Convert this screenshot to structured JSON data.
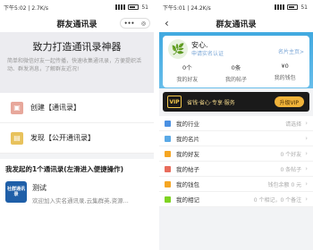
{
  "left": {
    "status": {
      "time": "下午5:02",
      "speed": "2.7K/s",
      "battery": "51"
    },
    "nav": {
      "title": "群友通讯录"
    },
    "hero": {
      "title": "致力打造通讯录神器",
      "desc": "简单和微信好友一起传播，快速收集通讯录，方便提织活动、群发消息，了解群友近况!"
    },
    "actions": [
      {
        "label": "创建【通讯录】"
      },
      {
        "label": "发现【公开通讯录】"
      }
    ],
    "section_title": "我发起的1个通讯录(左滑进入便捷操作)",
    "groups": [
      {
        "logo_text": "社群通讯录",
        "name": "测试",
        "desc": "欢迎加入实名通讯录,云集群英,资源..."
      }
    ]
  },
  "right": {
    "status": {
      "time": "下午5:01",
      "speed": "24.2K/s",
      "battery": "51"
    },
    "nav": {
      "title": "群友通讯录"
    },
    "profile": {
      "username": "安心.",
      "verify_link": "申请实名认证",
      "edit_link": "名片主页>",
      "stats": [
        {
          "value": "0个",
          "label": "我的好友"
        },
        {
          "value": "0条",
          "label": "我的帖子"
        },
        {
          "value": "¥0",
          "label": "我的钱包"
        }
      ]
    },
    "vip": {
      "badge": "VIP",
      "slogan": "省钱·省心·专享·服务",
      "button": "升级VIP"
    },
    "menu": [
      {
        "label": "我的行业",
        "value": "请选择",
        "color": "#4a90e2"
      },
      {
        "label": "我的名片",
        "value": "",
        "color": "#5aa9e6"
      },
      {
        "label": "我的好友",
        "value": "0 个好友",
        "color": "#f5a623"
      },
      {
        "label": "我的帖子",
        "value": "0 条帖子",
        "color": "#e86c5c"
      },
      {
        "label": "我的钱包",
        "value": "钱包余额 0 元",
        "color": "#f5a623"
      },
      {
        "label": "我的相记",
        "value": "0 个相记，0 个备注",
        "color": "#7ed321"
      }
    ]
  },
  "colors": {
    "accent": "#41a9e0",
    "vip_gold": "#f0b33a",
    "brand_blue": "#1f5fa8"
  }
}
